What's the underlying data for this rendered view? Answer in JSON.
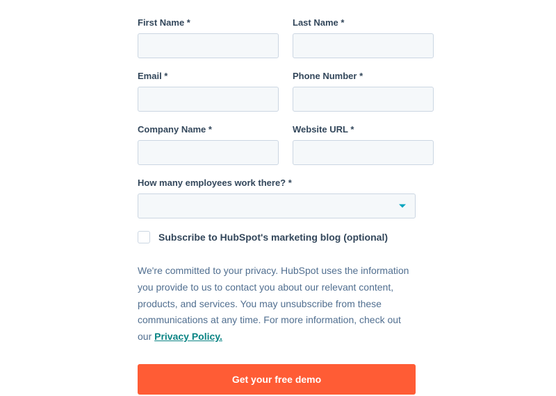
{
  "form": {
    "firstName": {
      "label": "First Name *",
      "value": ""
    },
    "lastName": {
      "label": "Last Name *",
      "value": ""
    },
    "email": {
      "label": "Email  *",
      "value": ""
    },
    "phone": {
      "label": "Phone Number *",
      "value": ""
    },
    "company": {
      "label": "Company Name *",
      "value": ""
    },
    "website": {
      "label": "Website URL *",
      "value": ""
    },
    "employees": {
      "label": "How many employees work there? *",
      "value": ""
    },
    "subscribe": {
      "label": "Subscribe to HubSpot's marketing blog (optional)",
      "checked": false
    },
    "privacyText": "We're committed to your privacy. HubSpot uses the information you provide to us to contact you about our relevant content, products, and services. You may unsubscribe from these communications at any time. For more information, check out our ",
    "privacyLinkLabel": "Privacy Policy.",
    "submitLabel": "Get your free demo"
  }
}
